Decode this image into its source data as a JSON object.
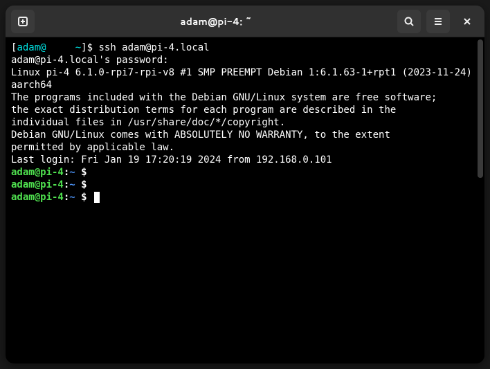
{
  "window": {
    "title": "adam@pi-4: ~"
  },
  "terminal": {
    "line0_a": "[",
    "line0_b": "adam@",
    "line0_c": "     ~",
    "line0_d": "]$ ssh adam@pi-4.local",
    "line1": "adam@pi-4.local's password:",
    "line2": "Linux pi-4 6.1.0-rpi7-rpi-v8 #1 SMP PREEMPT Debian 1:6.1.63-1+rpt1 (2023-11-24)",
    "line3": "aarch64",
    "line4": "",
    "line5": "The programs included with the Debian GNU/Linux system are free software;",
    "line6": "the exact distribution terms for each program are described in the",
    "line7": "individual files in /usr/share/doc/*/copyright.",
    "line8": "",
    "line9": "Debian GNU/Linux comes with ABSOLUTELY NO WARRANTY, to the extent",
    "line10": "permitted by applicable law.",
    "line11": "Last login: Fri Jan 19 17:20:19 2024 from 192.168.0.101",
    "prompt_userhost": "adam@pi-4",
    "prompt_colon": ":",
    "prompt_path": "~",
    "prompt_dollar": " $ "
  }
}
